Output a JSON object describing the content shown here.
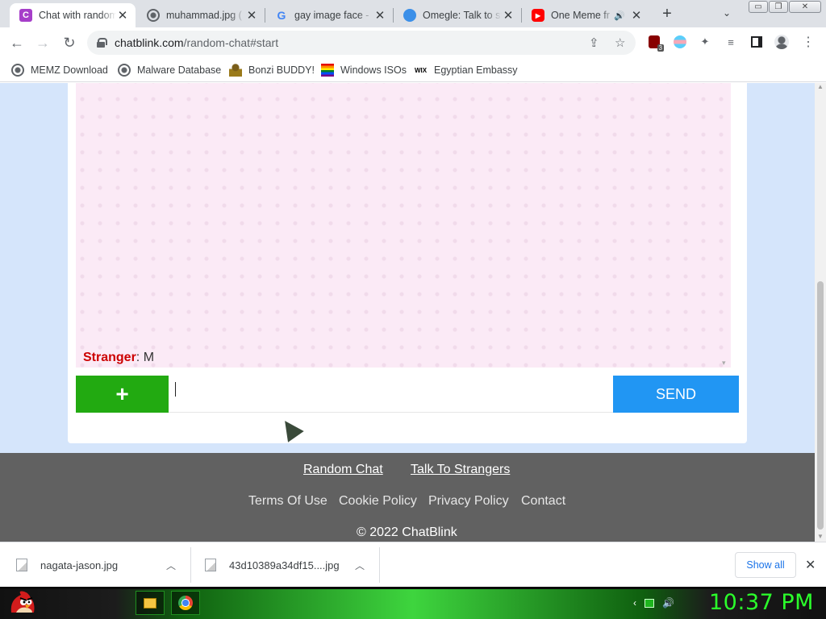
{
  "tabs": [
    {
      "title": "Chat with random",
      "favicon": "chatblink-logo",
      "fav_letter": "C",
      "active": true
    },
    {
      "title": "muhammad.jpg (",
      "favicon": "globe-icon"
    },
    {
      "title": "gay image face - ",
      "favicon": "google-logo",
      "fav_letter": "G"
    },
    {
      "title": "Omegle: Talk to st",
      "favicon": "omegle-logo"
    },
    {
      "title": "One Meme fr",
      "favicon": "youtube-logo",
      "audio": "speaker-icon"
    }
  ],
  "window_controls": {
    "minimize": "minimize-icon",
    "restore": "restore-icon",
    "close": "close-icon"
  },
  "address_bar": {
    "host": "chatblink.com",
    "path": "/random-chat#start"
  },
  "extensions": {
    "ublock_badge": "3"
  },
  "bookmarks": [
    {
      "label": "MEMZ Download",
      "icon": "globe-icon"
    },
    {
      "label": "Malware Database",
      "icon": "globe-icon"
    },
    {
      "label": "Bonzi BUDDY!",
      "icon": "bonzi-icon"
    },
    {
      "label": "Windows ISOs",
      "icon": "windows-flag-icon"
    },
    {
      "label": "Egyptian Embassy",
      "icon": "wix-icon",
      "icon_text": "WIX"
    }
  ],
  "chat": {
    "sender": "Stranger",
    "separator": ":",
    "message": " M",
    "add_label": "+",
    "send_label": "SEND",
    "input_value": ""
  },
  "footer": {
    "primary_links": [
      "Random Chat",
      "Talk To Strangers"
    ],
    "secondary_links": [
      "Terms Of Use",
      "Cookie Policy",
      "Privacy Policy",
      "Contact"
    ],
    "copyright": "© 2022 ChatBlink"
  },
  "downloads": [
    {
      "filename": "nagata-jason.jpg"
    },
    {
      "filename": "43d10389a34df15....jpg"
    }
  ],
  "download_shelf": {
    "show_all": "Show all"
  },
  "taskbar": {
    "clock": "10:37 PM"
  },
  "colors": {
    "page_bg": "#d5e5fb",
    "chat_bg": "#fbeaf6",
    "add_button": "#22aa11",
    "send_button": "#2196f3",
    "footer_bg": "#616161",
    "stranger_name": "#cc0000",
    "clock": "#2bff2b"
  }
}
